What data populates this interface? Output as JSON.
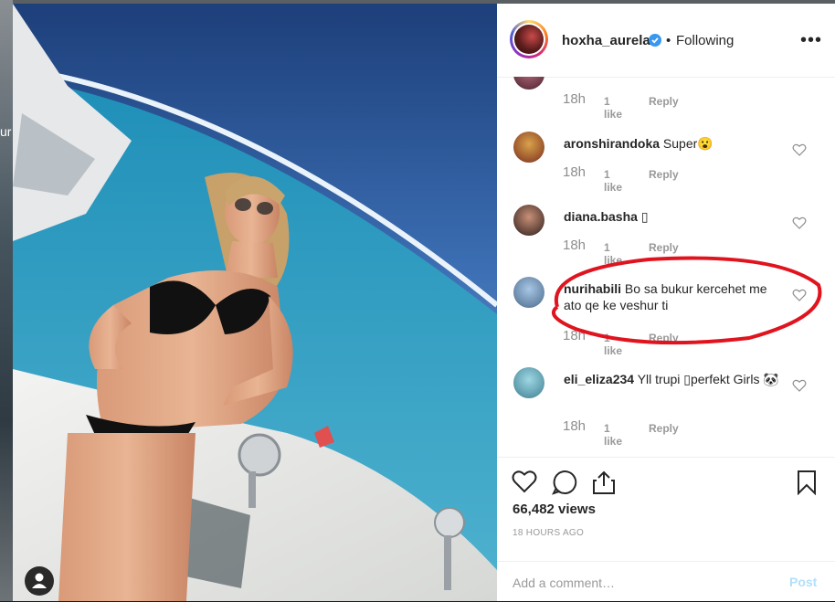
{
  "backdrop": {
    "partial_text": "ur"
  },
  "header": {
    "username": "hoxha_aurela",
    "separator": "•",
    "follow_status": "Following",
    "more": "•••"
  },
  "comments": [
    {
      "user": "",
      "text": "",
      "time": "18h",
      "likes": "1 like",
      "reply": "Reply"
    },
    {
      "user": "aronshirandoka",
      "text": "Super😮",
      "time": "18h",
      "likes": "1 like",
      "reply": "Reply"
    },
    {
      "user": "diana.basha",
      "text": "▯",
      "time": "18h",
      "likes": "1 like",
      "reply": "Reply"
    },
    {
      "user": "nurihabili",
      "text": "Bo sa bukur kercehet me ato qe ke veshur ti",
      "time": "18h",
      "likes": "1 like",
      "reply": "Reply"
    },
    {
      "user": "eli_eliza234",
      "text": "Yll trupi ▯perfekt Girls 🐼",
      "time": "18h",
      "likes": "1 like",
      "reply": "Reply"
    }
  ],
  "actions": {
    "views": "66,482 views",
    "time_ago": "18 HOURS AGO"
  },
  "add_comment": {
    "placeholder": "Add a comment…",
    "post_label": "Post"
  },
  "colors": {
    "accent": "#3897f0",
    "post_disabled": "#b2dffc",
    "annotation": "#e0141e"
  }
}
